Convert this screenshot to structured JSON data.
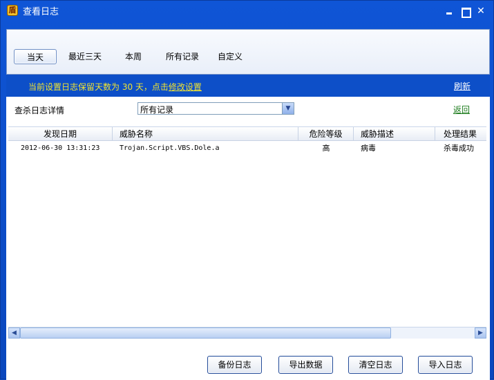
{
  "window": {
    "title": "查看日志",
    "logo_icon": "shield-icon",
    "controls": [
      "minimize-icon",
      "maximize-icon",
      "close-icon"
    ]
  },
  "tabs": [
    {
      "label": "当天",
      "active": true
    },
    {
      "label": "最近三天",
      "active": false
    },
    {
      "label": "本周",
      "active": false
    },
    {
      "label": "所有记录",
      "active": false
    },
    {
      "label": "自定义",
      "active": false
    }
  ],
  "retention": {
    "text": "当前设置日志保留天数为 30 天，点击",
    "link": "修改设置"
  },
  "refresh_label": "刷新",
  "detail": {
    "label": "查杀日志详情",
    "filter_value": "所有记录",
    "back_label": "返回"
  },
  "table": {
    "columns": [
      "发现日期",
      "威胁名称",
      "危险等级",
      "威胁描述",
      "处理结果"
    ],
    "rows": [
      [
        "2012-06-30 13:31:23",
        "Trojan.Script.VBS.Dole.a",
        "高",
        "病毒",
        "杀毒成功"
      ]
    ]
  },
  "buttons": {
    "backup": "备份日志",
    "export": "导出数据",
    "clear": "清空日志",
    "import": "导入日志"
  },
  "colors": {
    "frame_blue": "#0d4fc8",
    "notice_yellow": "#f0e330",
    "back_link_green": "#1a7a1a"
  }
}
